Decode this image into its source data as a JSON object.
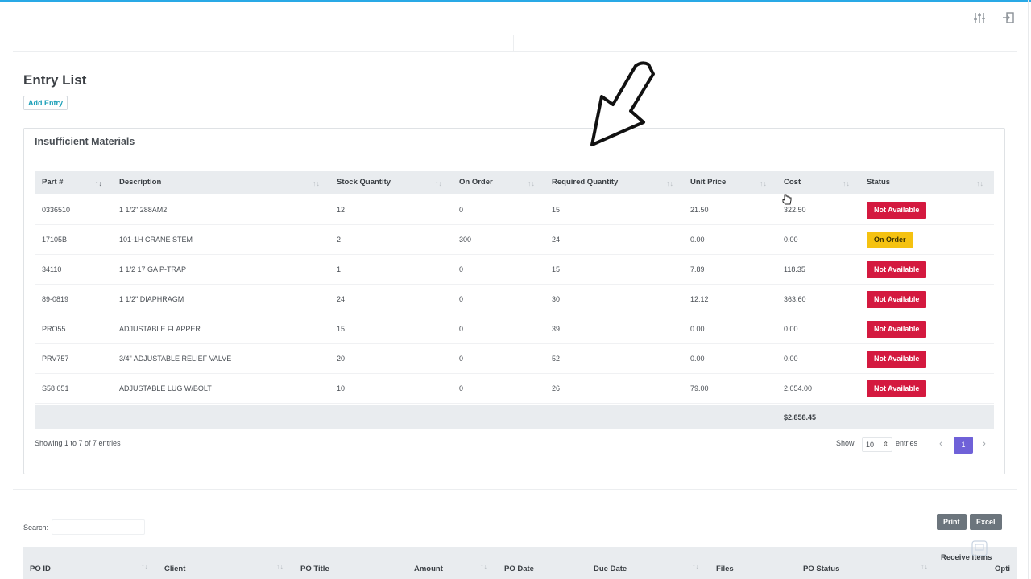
{
  "page": {
    "title": "Entry List",
    "add_entry_label": "Add Entry"
  },
  "card": {
    "title": "Insufficient Materials"
  },
  "table": {
    "columns": [
      "Part #",
      "Description",
      "Stock Quantity",
      "On Order",
      "Required Quantity",
      "Unit Price",
      "Cost",
      "Status"
    ],
    "rows": [
      {
        "part": "0336510",
        "desc": "1 1/2\" 288AM2",
        "stock": "12",
        "on_order": "0",
        "required": "15",
        "unit_price": "21.50",
        "cost": "322.50",
        "status": "Not Available"
      },
      {
        "part": "17105B",
        "desc": "101-1H CRANE STEM",
        "stock": "2",
        "on_order": "300",
        "required": "24",
        "unit_price": "0.00",
        "cost": "0.00",
        "status": "On Order"
      },
      {
        "part": "34110",
        "desc": "1 1/2 17 GA P-TRAP",
        "stock": "1",
        "on_order": "0",
        "required": "15",
        "unit_price": "7.89",
        "cost": "118.35",
        "status": "Not Available"
      },
      {
        "part": "89-0819",
        "desc": "1 1/2\" DIAPHRAGM",
        "stock": "24",
        "on_order": "0",
        "required": "30",
        "unit_price": "12.12",
        "cost": "363.60",
        "status": "Not Available"
      },
      {
        "part": "PRO55",
        "desc": "ADJUSTABLE FLAPPER",
        "stock": "15",
        "on_order": "0",
        "required": "39",
        "unit_price": "0.00",
        "cost": "0.00",
        "status": "Not Available"
      },
      {
        "part": "PRV757",
        "desc": "3/4\" ADJUSTABLE RELIEF VALVE",
        "stock": "20",
        "on_order": "0",
        "required": "52",
        "unit_price": "0.00",
        "cost": "0.00",
        "status": "Not Available"
      },
      {
        "part": "S58 051",
        "desc": "ADJUSTABLE LUG W/BOLT",
        "stock": "10",
        "on_order": "0",
        "required": "26",
        "unit_price": "79.00",
        "cost": "2,054.00",
        "status": "Not Available"
      }
    ],
    "total": "$2,858.45"
  },
  "pagination": {
    "showing": "Showing 1 to 7 of 7 entries",
    "show_label": "Show",
    "page_size": "10",
    "entries_label": "entries",
    "current_page": "1",
    "prev": "‹",
    "next": "›"
  },
  "po_section": {
    "search_label": "Search:",
    "print_label": "Print",
    "excel_label": "Excel",
    "columns": [
      "PO ID",
      "Client",
      "PO Title",
      "Amount",
      "PO Date",
      "Due Date",
      "Files",
      "PO Status",
      "Receive Items",
      "Opti"
    ]
  },
  "colors": {
    "accent": "#29a9e6",
    "not_available": "#d4193f",
    "on_order": "#f5c211",
    "page_active": "#6f61d8",
    "export_btn": "#6c757d"
  },
  "icons": [
    "sliders-icon",
    "logout-icon",
    "sort-icon",
    "chevron-left-icon",
    "chevron-right-icon",
    "pointer-arrow-icon",
    "hand-cursor-icon"
  ]
}
